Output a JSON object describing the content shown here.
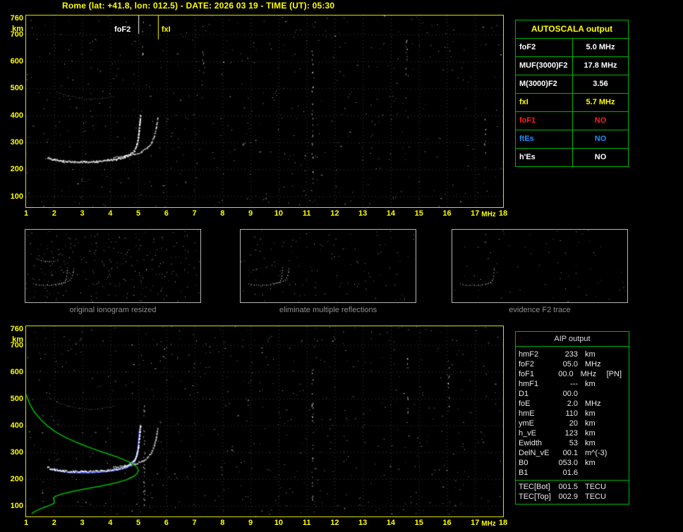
{
  "header": {
    "title": "Rome (lat: +41.8, lon: 012.5) - DATE: 2026 03 19 - TIME (UT): 05:30"
  },
  "axes": {
    "y_ticks": [
      760,
      700,
      600,
      500,
      400,
      300,
      200,
      100
    ],
    "y_unit": "km",
    "x_ticks": [
      1,
      2,
      3,
      4,
      5,
      6,
      7,
      8,
      9,
      10,
      11,
      12,
      13,
      14,
      15,
      16,
      17,
      18
    ],
    "x_unit": "MHz"
  },
  "top_plot": {
    "foF2_label": "foF2",
    "fxI_label": "fxI",
    "foF2_mhz": 5.0,
    "fxI_mhz": 5.7
  },
  "autoscala_table": {
    "title": "AUTOSCALA output",
    "rows": [
      {
        "label": "foF2",
        "value": "5.0 MHz",
        "color": "#ffffff"
      },
      {
        "label": "MUF(3000)F2",
        "value": "17.8 MHz",
        "color": "#ffffff"
      },
      {
        "label": "M(3000)F2",
        "value": "3.56",
        "color": "#ffffff"
      },
      {
        "label": "fxI",
        "value": "5.7 MHz",
        "color": "#ffff00"
      },
      {
        "label": "foF1",
        "value": "NO",
        "color": "#ff2020"
      },
      {
        "label": "ftEs",
        "value": "NO",
        "color": "#1e90ff"
      },
      {
        "label": "h'Es",
        "value": "NO",
        "color": "#ffffff"
      }
    ]
  },
  "thumbnails": [
    {
      "caption": "original ionogram resized"
    },
    {
      "caption": "eliminate multiple reflections"
    },
    {
      "caption": "evidence F2 trace"
    }
  ],
  "aip_table": {
    "title": "AIP output",
    "rows": [
      {
        "label": "hmF2",
        "value": "233",
        "unit": "km",
        "note": ""
      },
      {
        "label": "foF2",
        "value": "05.0",
        "unit": "MHz",
        "note": ""
      },
      {
        "label": "foF1",
        "value": "00.0",
        "unit": "MHz",
        "note": "[PN]"
      },
      {
        "label": "hmF1",
        "value": "---",
        "unit": "km",
        "note": ""
      },
      {
        "label": "D1",
        "value": "00.0",
        "unit": "",
        "note": ""
      },
      {
        "label": "foE",
        "value": "2.0",
        "unit": "MHz",
        "note": ""
      },
      {
        "label": "hmE",
        "value": "110",
        "unit": "km",
        "note": ""
      },
      {
        "label": "ymE",
        "value": "20",
        "unit": "km",
        "note": ""
      },
      {
        "label": "h_vE",
        "value": "123",
        "unit": "km",
        "note": ""
      },
      {
        "label": "Ewidth",
        "value": "53",
        "unit": "km",
        "note": ""
      },
      {
        "label": "DelN_vE",
        "value": "00.1",
        "unit": "m^(-3)",
        "note": ""
      },
      {
        "label": "B0",
        "value": "053.0",
        "unit": "km",
        "note": ""
      },
      {
        "label": "B1",
        "value": "01.6",
        "unit": "",
        "note": ""
      },
      {
        "label": "TEC[Bot]",
        "value": "001.5",
        "unit": "TECU",
        "note": "",
        "separator_above": true
      },
      {
        "label": "TEC[Top]",
        "value": "002.9",
        "unit": "TECU",
        "note": ""
      }
    ]
  },
  "chart_data": [
    {
      "id": "top_ionogram",
      "type": "scatter",
      "xlabel": "MHz",
      "ylabel": "km",
      "xlim": [
        1,
        18
      ],
      "ylim": [
        60,
        770
      ],
      "markers": {
        "foF2_mhz": 5.0,
        "fxI_mhz": 5.7
      },
      "series": [
        {
          "name": "second-reflection",
          "color": "#d8d8d8",
          "style": "echo-faint",
          "points": [
            [
              2.1,
              487
            ],
            [
              2.5,
              473
            ],
            [
              2.9,
              464
            ],
            [
              3.3,
              461
            ],
            [
              3.7,
              464
            ],
            [
              4.1,
              472
            ]
          ]
        },
        {
          "name": "F2-trace-X",
          "color": "#e8e8e8",
          "style": "echo-light",
          "points": [
            [
              4.1,
              247
            ],
            [
              4.5,
              250
            ],
            [
              4.85,
              257
            ],
            [
              5.1,
              267
            ],
            [
              5.3,
              281
            ],
            [
              5.45,
              300
            ],
            [
              5.55,
              326
            ],
            [
              5.62,
              356
            ],
            [
              5.67,
              390
            ]
          ]
        },
        {
          "name": "F2-trace-O",
          "color": "#ffffff",
          "style": "echo",
          "points": [
            [
              1.75,
              245
            ],
            [
              2.0,
              237
            ],
            [
              2.3,
              232
            ],
            [
              2.7,
              229
            ],
            [
              3.1,
              229
            ],
            [
              3.5,
              231
            ],
            [
              3.9,
              235
            ],
            [
              4.2,
              240
            ],
            [
              4.5,
              248
            ],
            [
              4.7,
              258
            ],
            [
              4.85,
              272
            ],
            [
              4.93,
              292
            ],
            [
              4.98,
              318
            ],
            [
              5.01,
              348
            ],
            [
              5.04,
              378
            ],
            [
              5.06,
              402
            ]
          ]
        }
      ]
    },
    {
      "id": "bottom_ionogram",
      "type": "scatter",
      "xlabel": "MHz",
      "ylabel": "km",
      "xlim": [
        1,
        18
      ],
      "ylim": [
        60,
        770
      ],
      "series": [
        {
          "name": "second-reflection",
          "color": "#d8d8d8",
          "style": "echo-faint",
          "points": [
            [
              2.1,
              487
            ],
            [
              2.5,
              473
            ],
            [
              2.9,
              464
            ],
            [
              3.3,
              461
            ],
            [
              3.7,
              464
            ],
            [
              4.1,
              472
            ]
          ]
        },
        {
          "name": "F2-trace-X",
          "color": "#e8e8e8",
          "style": "echo-light",
          "points": [
            [
              4.1,
              247
            ],
            [
              4.5,
              250
            ],
            [
              4.85,
              257
            ],
            [
              5.1,
              267
            ],
            [
              5.3,
              281
            ],
            [
              5.45,
              300
            ],
            [
              5.55,
              326
            ],
            [
              5.62,
              356
            ],
            [
              5.67,
              390
            ]
          ]
        },
        {
          "name": "autoscala-restored-trace",
          "color": "#4056f0",
          "style": "line2",
          "points": [
            [
              1.9,
              236
            ],
            [
              2.4,
              227
            ],
            [
              2.9,
              223
            ],
            [
              3.4,
              224
            ],
            [
              3.9,
              228
            ],
            [
              4.3,
              234
            ],
            [
              4.6,
              243
            ],
            [
              4.8,
              255
            ],
            [
              4.9,
              272
            ],
            [
              4.97,
              300
            ],
            [
              5.01,
              340
            ],
            [
              5.05,
              388
            ]
          ]
        },
        {
          "name": "F2-trace-O",
          "color": "#ffffff",
          "style": "echo",
          "points": [
            [
              1.75,
              245
            ],
            [
              2.0,
              237
            ],
            [
              2.3,
              232
            ],
            [
              2.7,
              229
            ],
            [
              3.1,
              229
            ],
            [
              3.5,
              231
            ],
            [
              3.9,
              235
            ],
            [
              4.2,
              240
            ],
            [
              4.5,
              248
            ],
            [
              4.7,
              258
            ],
            [
              4.85,
              272
            ],
            [
              4.93,
              292
            ],
            [
              4.98,
              318
            ],
            [
              5.01,
              348
            ],
            [
              5.04,
              378
            ],
            [
              5.06,
              402
            ]
          ]
        },
        {
          "name": "electron-density-profile",
          "color": "#00bb00",
          "style": "line",
          "points": [
            [
              1.0,
              515
            ],
            [
              1.12,
              482
            ],
            [
              1.28,
              452
            ],
            [
              1.5,
              424
            ],
            [
              1.75,
              399
            ],
            [
              2.05,
              376
            ],
            [
              2.45,
              353
            ],
            [
              2.9,
              332
            ],
            [
              3.35,
              314
            ],
            [
              3.85,
              296
            ],
            [
              4.3,
              280
            ],
            [
              4.62,
              266
            ],
            [
              4.83,
              254
            ],
            [
              4.95,
              244
            ],
            [
              5.0,
              233
            ],
            [
              4.96,
              221
            ],
            [
              4.84,
              210
            ],
            [
              4.58,
              197
            ],
            [
              4.18,
              185
            ],
            [
              3.68,
              174
            ],
            [
              3.15,
              164
            ],
            [
              2.68,
              154
            ],
            [
              2.3,
              145
            ],
            [
              2.06,
              136
            ],
            [
              1.97,
              128
            ],
            [
              2.0,
              119
            ],
            [
              2.0,
              110
            ],
            [
              1.88,
              103
            ],
            [
              1.66,
              95
            ],
            [
              1.45,
              86
            ],
            [
              1.3,
              78
            ],
            [
              1.2,
              70
            ]
          ]
        }
      ]
    }
  ]
}
